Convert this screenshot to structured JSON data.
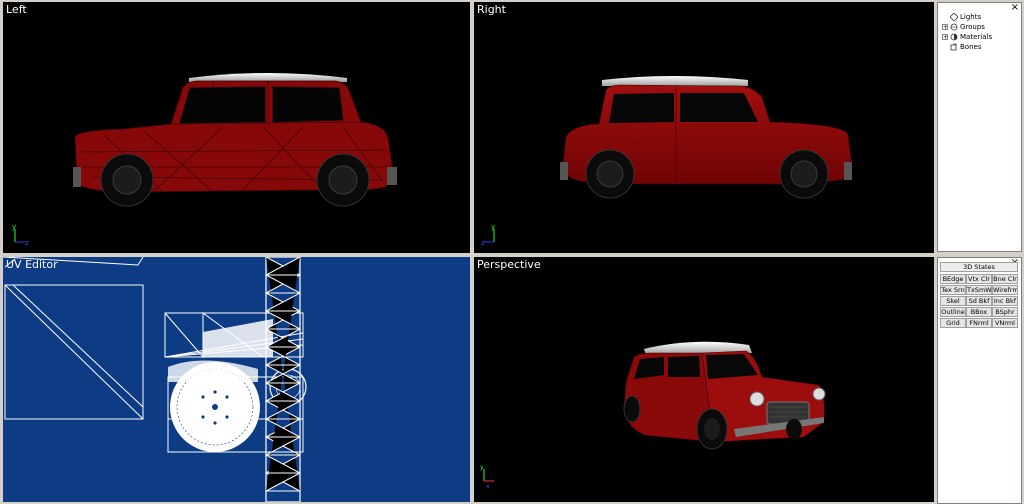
{
  "viewports": {
    "left": {
      "title": "Left"
    },
    "right": {
      "title": "Right"
    },
    "uv": {
      "title": "UV Editor"
    },
    "perspective": {
      "title": "Perspective"
    }
  },
  "tree": {
    "close": "×",
    "items": [
      {
        "label": "Lights",
        "icon": "light-icon",
        "expandable": false
      },
      {
        "label": "Groups",
        "icon": "groups-icon",
        "expandable": true
      },
      {
        "label": "Materials",
        "icon": "materials-icon",
        "expandable": true
      },
      {
        "label": "Bones",
        "icon": "bones-icon",
        "expandable": false
      }
    ]
  },
  "states": {
    "close": "×",
    "title": "3D States",
    "buttons": [
      [
        "BEdge",
        "Vtx Clr",
        "Bne Clr"
      ],
      [
        "Tex Srn",
        "TxSmWr",
        "Wirefrme"
      ],
      [
        "Skel",
        "Sd Bkf",
        "Inc Bkf"
      ],
      [
        "Outline",
        "BBox",
        "BSphr"
      ],
      [
        "Grid",
        "FNrml",
        "VNrml"
      ]
    ]
  },
  "colors": {
    "car_body": "#8a0a0a",
    "roof": "#e8e8e8",
    "uv_bg": "#0d3b84",
    "viewport_bg": "#000000"
  }
}
